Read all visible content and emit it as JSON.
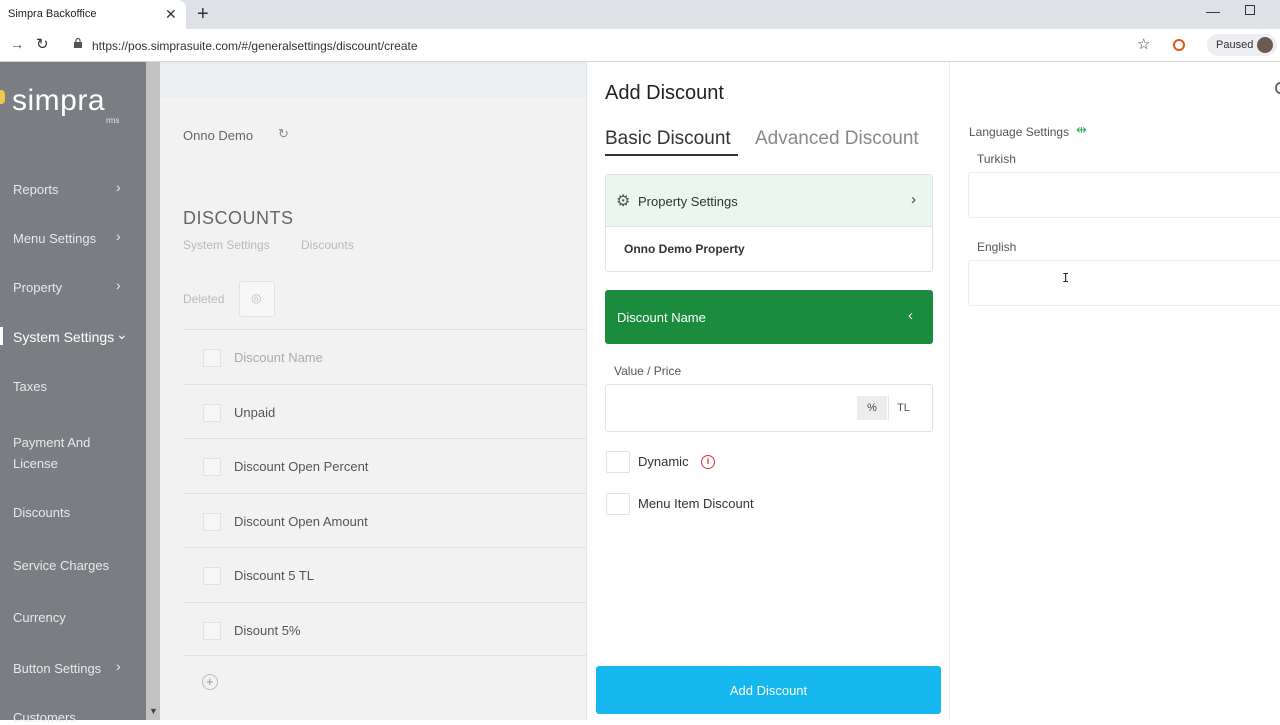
{
  "browser": {
    "tab_title": "Simpra Backoffice",
    "url": "https://pos.simprasuite.com/#/generalsettings/discount/create",
    "profile_status": "Paused"
  },
  "sidebar": {
    "logo": "simpra",
    "logo_sub": "rms",
    "items": [
      {
        "label": "Reports"
      },
      {
        "label": "Menu Settings"
      },
      {
        "label": "Property"
      },
      {
        "label": "System Settings"
      },
      {
        "label": "Taxes"
      },
      {
        "label": "Payment And License"
      },
      {
        "label": "Discounts"
      },
      {
        "label": "Service Charges"
      },
      {
        "label": "Currency"
      },
      {
        "label": "Button Settings"
      },
      {
        "label": "Customers"
      }
    ]
  },
  "content": {
    "property_name": "Onno Demo",
    "page_title": "DISCOUNTS",
    "breadcrumb": [
      "System Settings",
      "Discounts"
    ],
    "deleted_label": "Deleted",
    "table_header": "Discount Name",
    "rows": [
      "Unpaid",
      "Discount Open Percent",
      "Discount Open Amount",
      "Discount 5 TL",
      "Disount 5%"
    ]
  },
  "drawer": {
    "title": "Add Discount",
    "tabs": {
      "basic": "Basic Discount",
      "advanced": "Advanced Discount"
    },
    "property_settings": {
      "label": "Property Settings",
      "value": "Onno Demo Property"
    },
    "discount_name_label": "Discount Name",
    "value_price_label": "Value / Price",
    "value_price_value": "",
    "units": {
      "percent": "%",
      "currency": "TL"
    },
    "dynamic_label": "Dynamic",
    "menu_item_discount_label": "Menu Item Discount",
    "submit_label": "Add Discount",
    "language_settings": {
      "title": "Language Settings",
      "turkish_label": "Turkish",
      "turkish_value": "",
      "english_label": "English",
      "english_value": ""
    }
  },
  "colors": {
    "primary_green": "#1b8b3d",
    "light_green": "#eaf7ef",
    "primary_blue": "#16b6ef",
    "sidebar": "#7a7d82",
    "info_red": "#e0353a"
  }
}
